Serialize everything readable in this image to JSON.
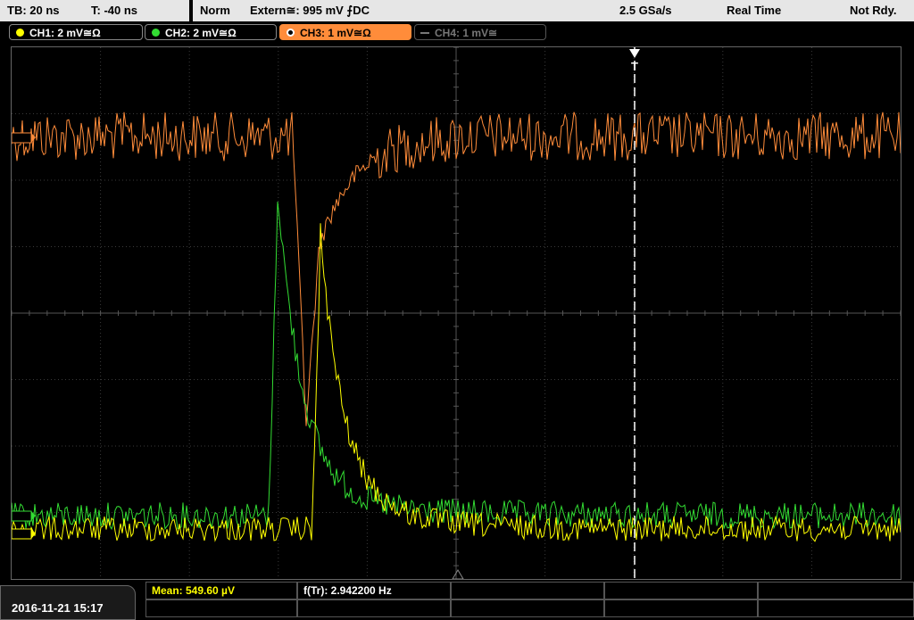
{
  "topbar": {
    "timebase": "TB: 20 ns",
    "trigger_offset": "T: -40 ns",
    "trigger_mode": "Norm",
    "trigger_source": "Extern≅: 995 mV ⨍DC",
    "sample_rate": "2.5 GSa/s",
    "acq_mode": "Real Time",
    "status": "Not Rdy."
  },
  "channels": [
    {
      "label": "CH1: 2 mV≅Ω",
      "color": "#ffff00",
      "active": true
    },
    {
      "label": "CH2: 2 mV≅Ω",
      "color": "#33dd33",
      "active": true
    },
    {
      "label": "CH3: 1 mV≅Ω",
      "color": "#ff8c3a",
      "active": true,
      "selected": true
    },
    {
      "label": "CH4: 1 mV≅",
      "color": "#777777",
      "active": false
    }
  ],
  "markers": {
    "trigger": "T"
  },
  "footer": {
    "datetime": "2016-11-21 15:17",
    "measurements": [
      {
        "label": "Mean: 549.60 µV",
        "color": "#ffff00"
      },
      {
        "label": "f(Tr): 2.942200 Hz",
        "color": "#ffffff"
      }
    ]
  },
  "colors": {
    "ch1": "#ffff00",
    "ch2": "#33dd33",
    "ch3": "#ff8c3a",
    "grid": "#555555",
    "background": "#000000"
  }
}
